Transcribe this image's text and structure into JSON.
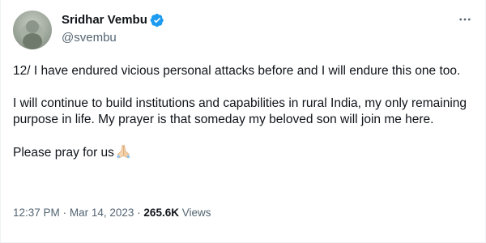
{
  "author": {
    "display_name": "Sridhar Vembu",
    "handle": "@svembu",
    "avatar_icon": "avatar-photo",
    "verified_icon": "verified-badge-icon",
    "verified_color": "#1d9bf0"
  },
  "more_icon": "more-options-icon",
  "tweet": {
    "paragraphs": [
      "12/ I have endured vicious personal attacks before and I will endure this one too.",
      "I will continue to build institutions and capabilities in rural India, my only remaining purpose in life. My prayer is that someday my beloved son will join me here."
    ],
    "closing_text": "Please pray for us",
    "closing_emoji_icon": "folded-hands-icon"
  },
  "meta": {
    "time": "12:37 PM",
    "separator": "·",
    "date": "Mar 14, 2023",
    "views_count": "265.6K",
    "views_label": "Views"
  },
  "colors": {
    "text_primary": "#0f1419",
    "text_secondary": "#536471",
    "border": "#eff3f4"
  }
}
